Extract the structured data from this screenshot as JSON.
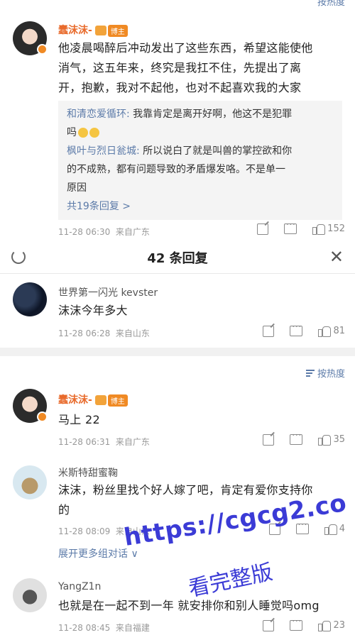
{
  "top_sort": {
    "label": "按热度"
  },
  "post1": {
    "username": "蠢沫沫-",
    "badge": "博主",
    "lines": [
      "他凌晨喝醉后冲动发出了这些东西，希望这能使他",
      "消气，这五年来，终究是我扛不住，先提出了离",
      "开，抱歉，我对不起他，也对不起喜欢我的大家"
    ],
    "replies": [
      {
        "user": "和清恋爱循环:",
        "text_l1": " 我靠肯定是离开好啊，他这不是犯罪",
        "text_l2": "吗"
      },
      {
        "user": "枫叶与烈日瓮城:",
        "text_l1": " 所以说白了就是叫兽的掌控欲和你",
        "text_l2": "的不成熟，都有问题导致的矛盾爆发咯。不是单一",
        "text_l3": "原因"
      }
    ],
    "more_replies": "共19条回复 >",
    "time": "11-28 06:30",
    "location": "来自广东",
    "likes": "152"
  },
  "header": {
    "title": "42 条回复"
  },
  "comment1": {
    "username": "世界第一闪光 kevster",
    "text": "沫沫今年多大",
    "time": "11-28 06:28",
    "location": "来自山东",
    "likes": "81"
  },
  "sort": {
    "label": "按热度"
  },
  "comment2": {
    "username": "蠢沫沫-",
    "badge": "博主",
    "text": "马上 22",
    "time": "11-28 06:31",
    "location": "来自广东",
    "likes": "35"
  },
  "comment3": {
    "username": "米斯特甜蜜鞠",
    "line1": "沫沫，粉丝里找个好人嫁了吧，肯定有爱你支持你",
    "line2": "的",
    "time": "11-28 08:09",
    "location": "来自山东",
    "likes": "4",
    "expand": "展开更多组对话 ∨"
  },
  "comment4": {
    "username": "YangZ1n",
    "text": "也就是在一起不到一年 就安排你和别人睡觉吗omg",
    "time": "11-28 08:45",
    "location": "来自福建",
    "likes": "23"
  },
  "watermark": {
    "url": "https://cgcg2.co",
    "text": "看完整版"
  }
}
